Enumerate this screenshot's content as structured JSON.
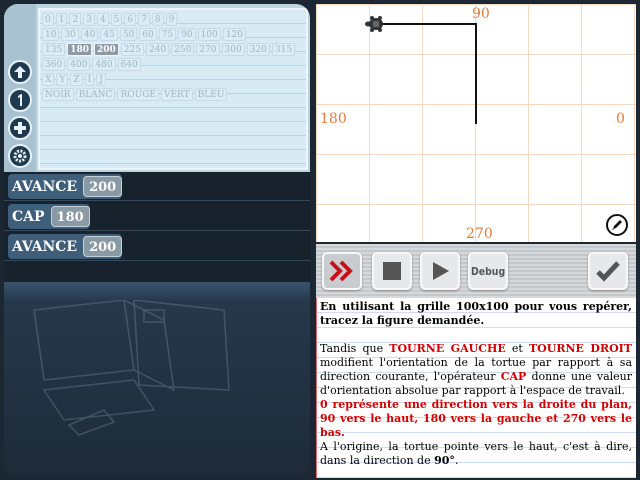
{
  "palette": {
    "row1": [
      "0",
      "1",
      "2",
      "3",
      "4",
      "5",
      "6",
      "7",
      "8",
      "9"
    ],
    "row2": [
      "10",
      "30",
      "40",
      "45",
      "50",
      "60",
      "75",
      "90",
      "100",
      "120"
    ],
    "row3": [
      "135",
      "180",
      "200",
      "225",
      "240",
      "250",
      "270",
      "300",
      "320",
      "315"
    ],
    "row4": [
      "360",
      "400",
      "480",
      "640"
    ],
    "row5": [
      "X",
      "Y",
      "Z",
      "I",
      "J"
    ],
    "row6": [
      "NOIR",
      "BLANC",
      "ROUGE",
      "VERT",
      "BLEU"
    ],
    "selected": [
      "180",
      "200"
    ]
  },
  "sidebar_icons": [
    "arrow-up-icon",
    "one-icon",
    "plus-icon",
    "gear-icon"
  ],
  "program": [
    {
      "keyword": "AVANCE",
      "arg": "200"
    },
    {
      "keyword": "CAP",
      "arg": "180"
    },
    {
      "keyword": "AVANCE",
      "arg": "200"
    }
  ],
  "canvas": {
    "labels": {
      "top": "90",
      "left": "180",
      "right": "0",
      "bottom": "270"
    }
  },
  "toolbar": {
    "debug_label": "Debug",
    "buttons": [
      "fast-forward-icon",
      "stop-icon",
      "play-icon",
      "debug-button",
      "check-icon"
    ]
  },
  "instructions": {
    "p1": "En utilisant la grille 100x100 pour vous repérer, tracez la figure demandée.",
    "p2_a": "Tandis que ",
    "p2_kw1": "TOURNE GAUCHE",
    "p2_b": " et ",
    "p2_kw2": "TOURNE DROIT",
    "p2_c": " modifient l'orientation de la tortue par rapport à sa direction courante, l'opérateur ",
    "p2_kw3": "CAP",
    "p2_d": " donne une valeur d'orientation absolue par rapport à l'espace de travail.",
    "p3": "0 représente une direction vers la droite du plan, 90 vers le haut, 180 vers la gauche et 270 vers le bas.",
    "p4_a": "A l'origine, la tortue pointe vers le haut, c'est à dire, dans la direction de ",
    "p4_b": "90°",
    "p4_c": "."
  },
  "colors": {
    "accent_red": "#d40000",
    "direction_orange": "#e07a3a"
  }
}
